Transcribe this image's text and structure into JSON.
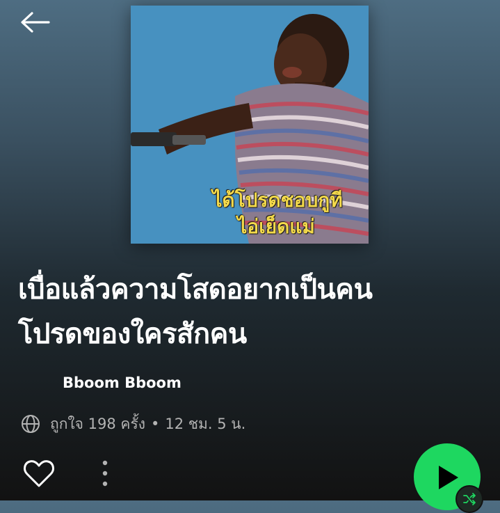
{
  "header": {
    "back_icon": "arrow-left-icon"
  },
  "cover": {
    "caption_line1": "ได้โปรดชอบกูที",
    "caption_line2": "ไอ่เย็ดแม่",
    "caption_color": "#f3d94b",
    "background_color": "#4b95c4"
  },
  "playlist": {
    "title_line1": "เบื่อแล้วความโสดอยากเป็นคน",
    "title_line2": "โปรดของใครสักคน",
    "owner": "Bboom Bboom",
    "likes": "ถูกใจ 198 ครั้ง",
    "separator": "•",
    "duration": "12 ชม. 5 น.",
    "visibility_icon": "globe-icon"
  },
  "actions": {
    "like_icon": "heart-outline-icon",
    "more_icon": "more-vertical-icon",
    "play_icon": "play-icon",
    "shuffle_icon": "shuffle-icon",
    "accent_color": "#1ed760"
  }
}
